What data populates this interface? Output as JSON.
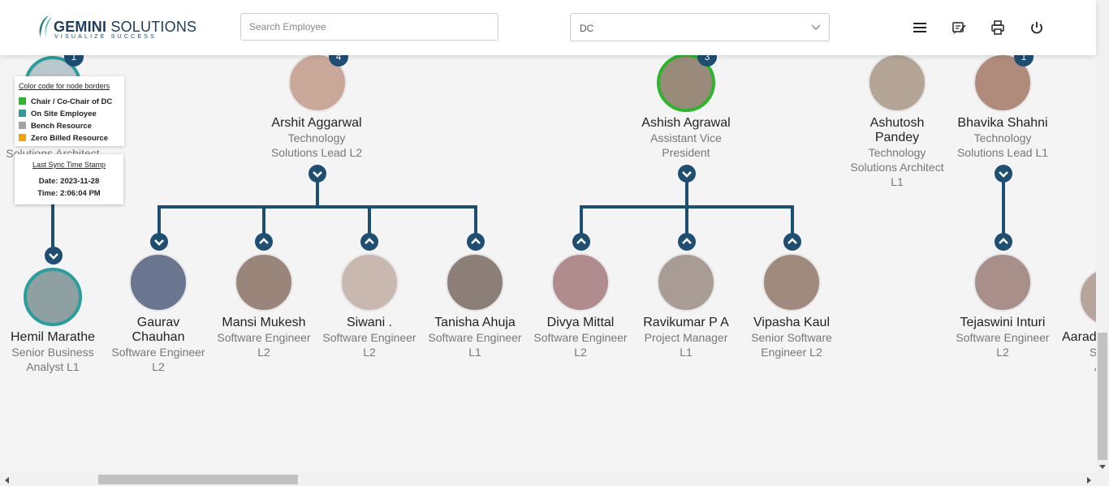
{
  "brand": {
    "name_bold": "GEMINI",
    "name_rest": " SOLUTIONS",
    "tagline": "VISUALIZE SUCCESS"
  },
  "search": {
    "placeholder": "Search Employee",
    "value": ""
  },
  "filter": {
    "selected": "DC"
  },
  "header_icons": [
    "menu-icon",
    "feedback-icon",
    "print-icon",
    "power-icon"
  ],
  "legend": {
    "title": "Color code for node borders",
    "items": [
      {
        "label": "Chair / Co-Chair of DC",
        "color": "#2db52d"
      },
      {
        "label": "On Site Employee",
        "color": "#2a9d9d"
      },
      {
        "label": "Bench Resource",
        "color": "#a3a3a3"
      },
      {
        "label": "Zero Billed Resource",
        "color": "#f5a300"
      }
    ]
  },
  "sync": {
    "title": "Last Sync Time Stamp",
    "date": "Date: 2023-11-28",
    "time": "Time: 2:06:04 PM"
  },
  "colors": {
    "node_line": "#1f4e73",
    "chair_border": "#2db52d",
    "onsite_border": "#2a9d9d"
  },
  "top_nodes": {
    "partial_left": {
      "role": "Solutions Architect",
      "badge": "1"
    },
    "arshit": {
      "name": "Arshit Aggarwal",
      "line1": "Technology",
      "line2": "Solutions Lead L2",
      "badge": "4"
    },
    "ashish": {
      "name": "Ashish Agrawal",
      "line1": "Assistant Vice",
      "line2": "President",
      "badge": "3"
    },
    "ashutosh": {
      "name1": "Ashutosh",
      "name2": "Pandey",
      "line1": "Technology",
      "line2": "Solutions Architect",
      "line3": "L1"
    },
    "bhavika": {
      "name": "Bhavika Shahni",
      "line1": "Technology",
      "line2": "Solutions Lead L1",
      "badge": "1"
    }
  },
  "child_nodes": {
    "hemil": {
      "name": "Hemil Marathe",
      "line1": "Senior Business",
      "line2": "Analyst L1"
    },
    "gaurav": {
      "name1": "Gaurav",
      "name2": "Chauhan",
      "line1": "Software Engineer",
      "line2": "L2"
    },
    "mansi": {
      "name": "Mansi Mukesh",
      "line1": "Software Engineer",
      "line2": "L2"
    },
    "siwani": {
      "name": "Siwani .",
      "line1": "Software Engineer",
      "line2": "L2"
    },
    "tanisha": {
      "name": "Tanisha Ahuja",
      "line1": "Software Engineer",
      "line2": "L1"
    },
    "divya": {
      "name": "Divya Mittal",
      "line1": "Software Engineer",
      "line2": "L2"
    },
    "ravikumar": {
      "name": "Ravikumar P A",
      "line1": "Project Manager",
      "line2": "L1"
    },
    "vipasha": {
      "name": "Vipasha Kaul",
      "line1": "Senior Software",
      "line2": "Engineer L2"
    },
    "tejaswini": {
      "name": "Tejaswini Inturi",
      "line1": "Software Engineer",
      "line2": "L2"
    },
    "partial_right": {
      "name": "Aarad",
      "line1": "Senio",
      "line2": "An"
    }
  }
}
